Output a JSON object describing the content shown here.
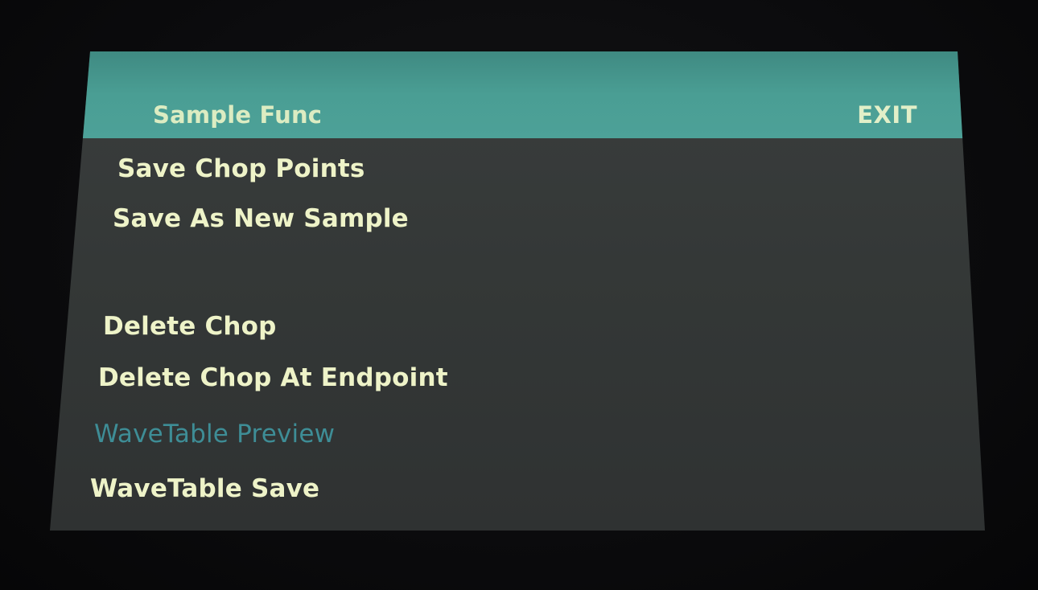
{
  "header": {
    "title": "Sample Func",
    "exit_label": "EXIT"
  },
  "menu": {
    "items": [
      {
        "label": "Save Chop Points",
        "enabled": true
      },
      {
        "label": "Save As New Sample",
        "enabled": true
      },
      {
        "label": "Delete Chop",
        "enabled": true
      },
      {
        "label": "Delete Chop At Endpoint",
        "enabled": true
      },
      {
        "label": "WaveTable Preview",
        "enabled": false
      },
      {
        "label": "WaveTable Save",
        "enabled": true
      }
    ]
  },
  "colors": {
    "header_bg": "#4a9e94",
    "screen_bg": "#363a39",
    "text_active": "#eef3c8",
    "text_disabled": "#3e8d96"
  }
}
